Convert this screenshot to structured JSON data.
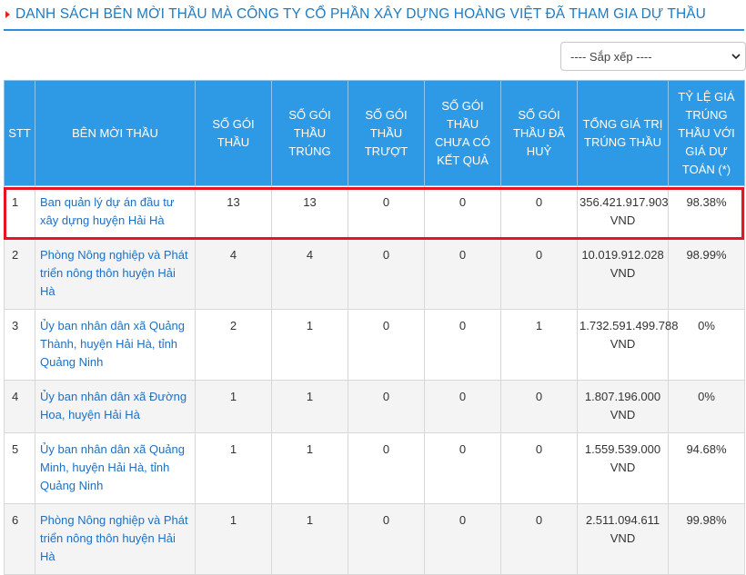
{
  "title": "DANH SÁCH BÊN MỜI THẦU MÀ CÔNG TY CỔ PHẦN XÂY DỰNG HOÀNG VIỆT ĐÃ THAM GIA DỰ THẦU",
  "sort": {
    "selected": "---- Sắp xếp ----"
  },
  "columns": [
    "STT",
    "BÊN MỜI THẦU",
    "SỐ GÓI THẦU",
    "SỐ GÓI THẦU TRÚNG",
    "SỐ GÓI THẦU TRƯỢT",
    "SỐ GÓI THẦU CHƯA CÓ KẾT QUẢ",
    "SỐ GÓI THẦU ĐÃ HUỶ",
    "TỔNG GIÁ TRỊ TRÚNG THẦU",
    "TỶ LỆ GIÁ TRÚNG THẦU VỚI GIÁ DỰ TOÁN (*)"
  ],
  "rows": [
    {
      "stt": "1",
      "name": "Ban quản lý dự án đầu tư xây dựng huyện Hải Hà",
      "total": "13",
      "won": "13",
      "lost": "0",
      "pending": "0",
      "cancelled": "0",
      "value": "356.421.917.903 VND",
      "ratio": "98.38%"
    },
    {
      "stt": "2",
      "name": "Phòng Nông nghiệp và Phát triển nông thôn huyện Hải Hà",
      "total": "4",
      "won": "4",
      "lost": "0",
      "pending": "0",
      "cancelled": "0",
      "value": "10.019.912.028 VND",
      "ratio": "98.99%"
    },
    {
      "stt": "3",
      "name": "Ủy ban nhân dân xã Quảng Thành, huyện Hải Hà, tỉnh Quảng Ninh",
      "total": "2",
      "won": "1",
      "lost": "0",
      "pending": "0",
      "cancelled": "1",
      "value": "1.732.591.499.788 VND",
      "ratio": "0%"
    },
    {
      "stt": "4",
      "name": "Ủy ban nhân dân xã Đường Hoa, huyện Hải Hà",
      "total": "1",
      "won": "1",
      "lost": "0",
      "pending": "0",
      "cancelled": "0",
      "value": "1.807.196.000 VND",
      "ratio": "0%"
    },
    {
      "stt": "5",
      "name": "Ủy ban nhân dân xã Quảng Minh, huyện Hải Hà, tỉnh Quảng Ninh",
      "total": "1",
      "won": "1",
      "lost": "0",
      "pending": "0",
      "cancelled": "0",
      "value": "1.559.539.000 VND",
      "ratio": "94.68%"
    },
    {
      "stt": "6",
      "name": "Phòng Nông nghiệp và Phát triển nông thôn huyện Hải Hà",
      "total": "1",
      "won": "1",
      "lost": "0",
      "pending": "0",
      "cancelled": "0",
      "value": "2.511.094.611 VND",
      "ratio": "99.98%"
    }
  ]
}
